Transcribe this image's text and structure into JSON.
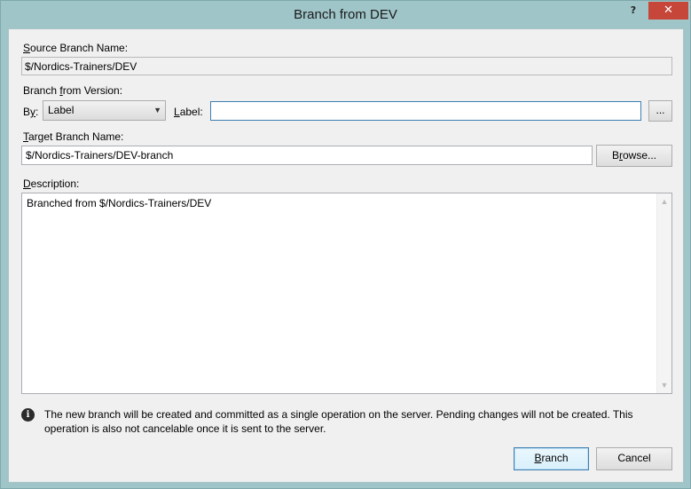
{
  "window": {
    "title": "Branch from DEV",
    "help_label": "?",
    "close_label": "✕"
  },
  "source": {
    "label_pre": "",
    "label_u": "S",
    "label_post": "ource Branch Name:",
    "value": "$/Nordics-Trainers/DEV"
  },
  "version": {
    "label_pre": "Branch ",
    "label_u": "f",
    "label_post": "rom Version:",
    "by_label_pre": "B",
    "by_label_u": "y",
    "by_label_post": ":",
    "by_value": "Label",
    "label_field_label_pre": "",
    "label_field_label_u": "L",
    "label_field_label_post": "abel:",
    "label_value": "",
    "browse_label": "..."
  },
  "target": {
    "label_pre": "",
    "label_u": "T",
    "label_post": "arget Branch Name:",
    "value": "$/Nordics-Trainers/DEV-branch",
    "browse_pre": "B",
    "browse_u": "r",
    "browse_post": "owse..."
  },
  "description": {
    "label_pre": "",
    "label_u": "D",
    "label_post": "escription:",
    "value": "Branched from $/Nordics-Trainers/DEV"
  },
  "info": {
    "icon": "info-icon",
    "line1": "The new branch will be created and committed as a single operation on the server. Pending changes will not be created. This",
    "line2": "operation is also not cancelable once it is sent to the server."
  },
  "buttons": {
    "branch_pre": "",
    "branch_u": "B",
    "branch_post": "ranch",
    "cancel": "Cancel"
  },
  "colors": {
    "title_bg": "#9fc5c8",
    "client_bg": "#f0f0f0",
    "close_bg": "#c7463a",
    "focus_border": "#3c7fb1"
  }
}
